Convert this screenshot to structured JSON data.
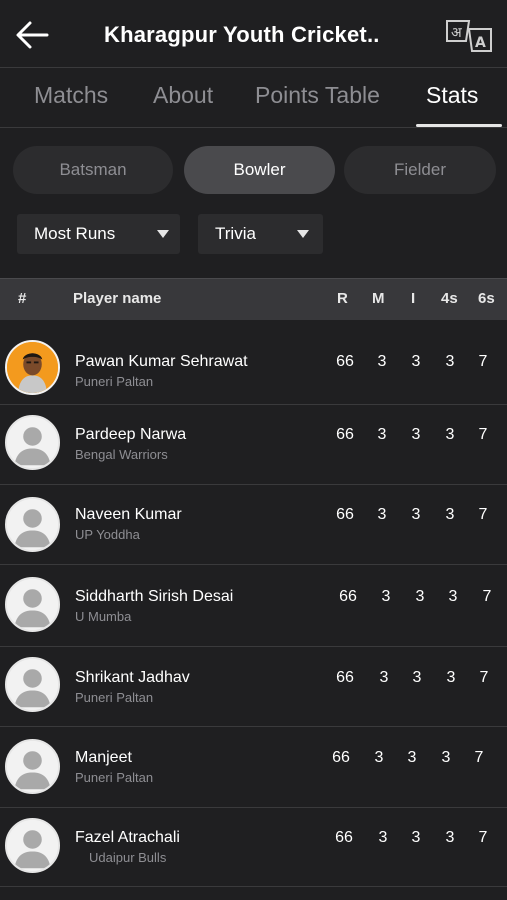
{
  "header": {
    "title": "Kharagpur Youth Cricket..",
    "back_icon": "arrow-left-icon",
    "translate_icon": "translate-icon",
    "translate_glyph_a": "अ",
    "translate_glyph_b": "A"
  },
  "tabs": [
    {
      "label": "Matchs",
      "active": false
    },
    {
      "label": "About",
      "active": false
    },
    {
      "label": "Points Table",
      "active": false
    },
    {
      "label": "Stats",
      "active": true
    }
  ],
  "segments": [
    {
      "label": "Batsman",
      "active": false
    },
    {
      "label": "Bowler",
      "active": true
    },
    {
      "label": "Fielder",
      "active": false
    }
  ],
  "filters": {
    "sort": "Most Runs",
    "category": "Trivia"
  },
  "table": {
    "headers": {
      "rank": "#",
      "player": "Player name",
      "r": "R",
      "m": "M",
      "i": "I",
      "fours": "4s",
      "sixes": "6s"
    },
    "rows": [
      {
        "name": "Pawan Kumar Sehrawat",
        "team": "Puneri Paltan",
        "r": "66",
        "m": "3",
        "i": "3",
        "fours": "3",
        "sixes": "7",
        "avatar": "player-photo"
      },
      {
        "name": "Pardeep Narwa",
        "team": "Bengal Warriors",
        "r": "66",
        "m": "3",
        "i": "3",
        "fours": "3",
        "sixes": "7",
        "avatar": "default-avatar-icon"
      },
      {
        "name": "Naveen Kumar",
        "team": "UP Yoddha",
        "r": "66",
        "m": "3",
        "i": "3",
        "fours": "3",
        "sixes": "7",
        "avatar": "default-avatar-icon"
      },
      {
        "name": "Siddharth Sirish Desai",
        "team": "U Mumba",
        "r": "66",
        "m": "3",
        "i": "3",
        "fours": "3",
        "sixes": "7",
        "avatar": "default-avatar-icon"
      },
      {
        "name": "Shrikant Jadhav",
        "team": "Puneri Paltan",
        "r": "66",
        "m": "3",
        "i": "3",
        "fours": "3",
        "sixes": "7",
        "avatar": "default-avatar-icon"
      },
      {
        "name": "Manjeet",
        "team": "Puneri Paltan",
        "r": "66",
        "m": "3",
        "i": "3",
        "fours": "3",
        "sixes": "7",
        "avatar": "default-avatar-icon"
      },
      {
        "name": "Fazel Atrachali",
        "team": "Udaipur Bulls",
        "r": "66",
        "m": "3",
        "i": "3",
        "fours": "3",
        "sixes": "7",
        "avatar": "default-avatar-icon"
      }
    ]
  },
  "colors": {
    "background": "#1f1f21",
    "header_row": "#38383b",
    "pill": "#2c2c2e",
    "pill_active": "#4a4a4d",
    "muted_text": "#8e8e93",
    "photo_bg": "#f39a1e"
  }
}
